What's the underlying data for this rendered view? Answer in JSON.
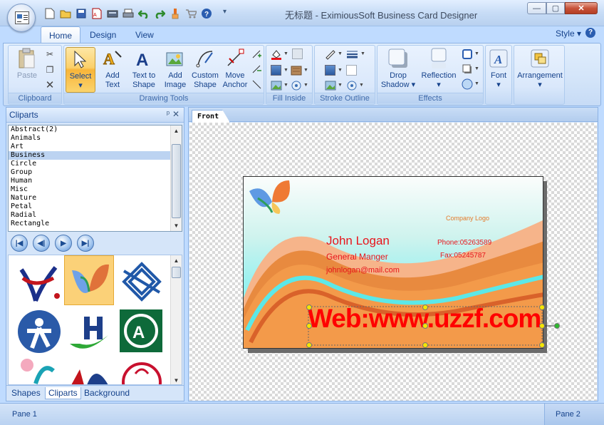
{
  "window": {
    "title": "无标题 - EximiousSoft Business Card Designer",
    "min_label": "—",
    "max_label": "▢",
    "close_label": "✕"
  },
  "qat": {
    "icons": [
      "new-icon",
      "open-icon",
      "save-icon",
      "pdf-icon",
      "scan-icon",
      "print-icon",
      "undo-icon",
      "redo-icon",
      "brush-icon",
      "cart-icon",
      "help-icon"
    ],
    "more_label": "▾"
  },
  "tabs": [
    {
      "label": "Home",
      "active": true
    },
    {
      "label": "Design",
      "active": false
    },
    {
      "label": "View",
      "active": false
    }
  ],
  "style_menu": "Style ▾",
  "help_label": "?",
  "ribbon": {
    "clipboard": {
      "label": "Clipboard",
      "paste": "Paste"
    },
    "drawing_tools": {
      "label": "Drawing Tools",
      "select": "Select",
      "select_arrow": "▾",
      "add_text": "Add\nText",
      "text_to_shape": "Text to\nShape",
      "add_image": "Add\nImage",
      "custom_shape": "Custom\nShape",
      "move_anchor": "Move\nAnchor"
    },
    "fill_inside": {
      "label": "Fill Inside"
    },
    "stroke_outline": {
      "label": "Stroke Outline"
    },
    "effects": {
      "label": "Effects",
      "drop_shadow": "Drop\nShadow ▾",
      "reflection": "Reflection\n▾"
    },
    "font": {
      "label": "Font",
      "arrow": "▾"
    },
    "arrangement": {
      "label": "Arrangement",
      "arrow": "▾"
    }
  },
  "cliparts_panel": {
    "title": "Cliparts",
    "pin": "ᵖ",
    "close": "✕",
    "categories": [
      "Abstract(2)",
      "Animals",
      "Art",
      "Business",
      "Circle",
      "Group",
      "Human",
      "Misc",
      "Nature",
      "Petal",
      "Radial",
      "Rectangle"
    ],
    "selected_category": "Business",
    "nav_buttons": [
      "|◀",
      "◀|",
      "▶",
      "▶|"
    ],
    "tabs": [
      {
        "label": "Shapes",
        "active": false
      },
      {
        "label": "Cliparts",
        "active": true
      },
      {
        "label": "Background",
        "active": false
      }
    ]
  },
  "document": {
    "tab": "Front"
  },
  "card": {
    "company_logo": "Company Logo",
    "name": "John Logan",
    "title": "General Manger",
    "email": "johnlogan@mail.com",
    "phone": "Phone:05263589",
    "fax": "Fax:05245787",
    "watermark": "Web:www.uzzf.com",
    "colors": {
      "name": "#e8141b",
      "watermark": "#ff0000",
      "accent": "#f08a3c"
    }
  },
  "status": {
    "pane1": "Pane 1",
    "pane2": "Pane 2"
  }
}
